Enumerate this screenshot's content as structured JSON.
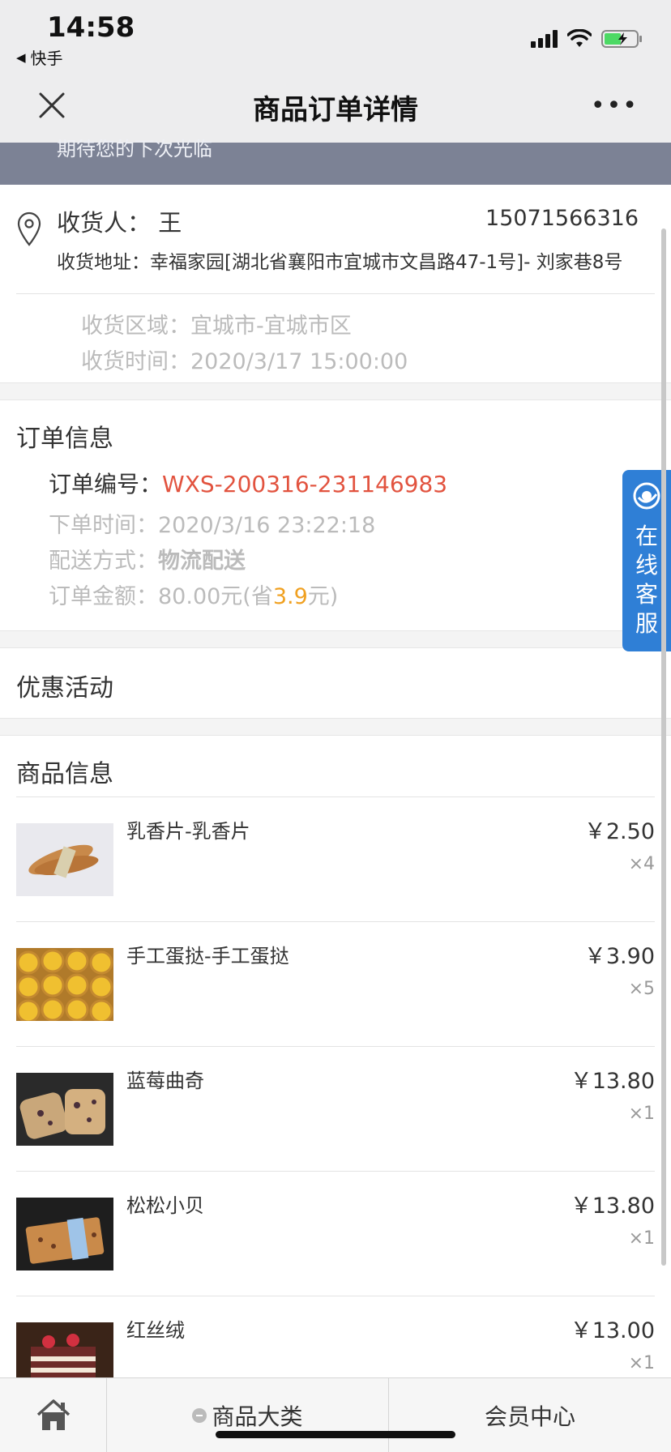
{
  "status_bar": {
    "time": "14:58",
    "back_app": "快手"
  },
  "nav": {
    "title": "商品订单详情",
    "more": "•••"
  },
  "banner": {
    "text": "期待您的下次光临"
  },
  "receiver": {
    "name_label": "收货人： 王",
    "phone": "15071566316",
    "address": "收货地址：幸福家园[湖北省襄阳市宜城市文昌路47-1号]- 刘家巷8号",
    "area": "收货区域：宜城市-宜城市区",
    "time": "收货时间：2020/3/17 15:00:00"
  },
  "order": {
    "title": "订单信息",
    "number_label": "订单编号：",
    "number": "WXS-200316-231146983",
    "time": "下单时间：2020/3/16 23:22:18",
    "delivery_label": "配送方式：",
    "delivery_value": "物流配送",
    "amount_prefix": "订单金额：80.00元(省",
    "amount_saved": "3.9",
    "amount_suffix": "元)"
  },
  "promo": {
    "title": "优惠活动"
  },
  "products": {
    "title": "商品信息",
    "items": [
      {
        "name": "乳香片-乳香片",
        "price": "￥2.50",
        "qty": "×4"
      },
      {
        "name": "手工蛋挞-手工蛋挞",
        "price": "￥3.90",
        "qty": "×5"
      },
      {
        "name": "蓝莓曲奇",
        "price": "￥13.80",
        "qty": "×1"
      },
      {
        "name": "松松小贝",
        "price": "￥13.80",
        "qty": "×1"
      },
      {
        "name": "红丝绒",
        "price": "￥13.00",
        "qty": "×1"
      }
    ]
  },
  "customer_service": {
    "label": "在线客服"
  },
  "tabbar": {
    "category": "商品大类",
    "member": "会员中心"
  },
  "colors": {
    "accent_red": "#e2533f",
    "saved_orange": "#f0a020",
    "cs_blue": "#2f7fd6",
    "banner": "#7c8295"
  }
}
